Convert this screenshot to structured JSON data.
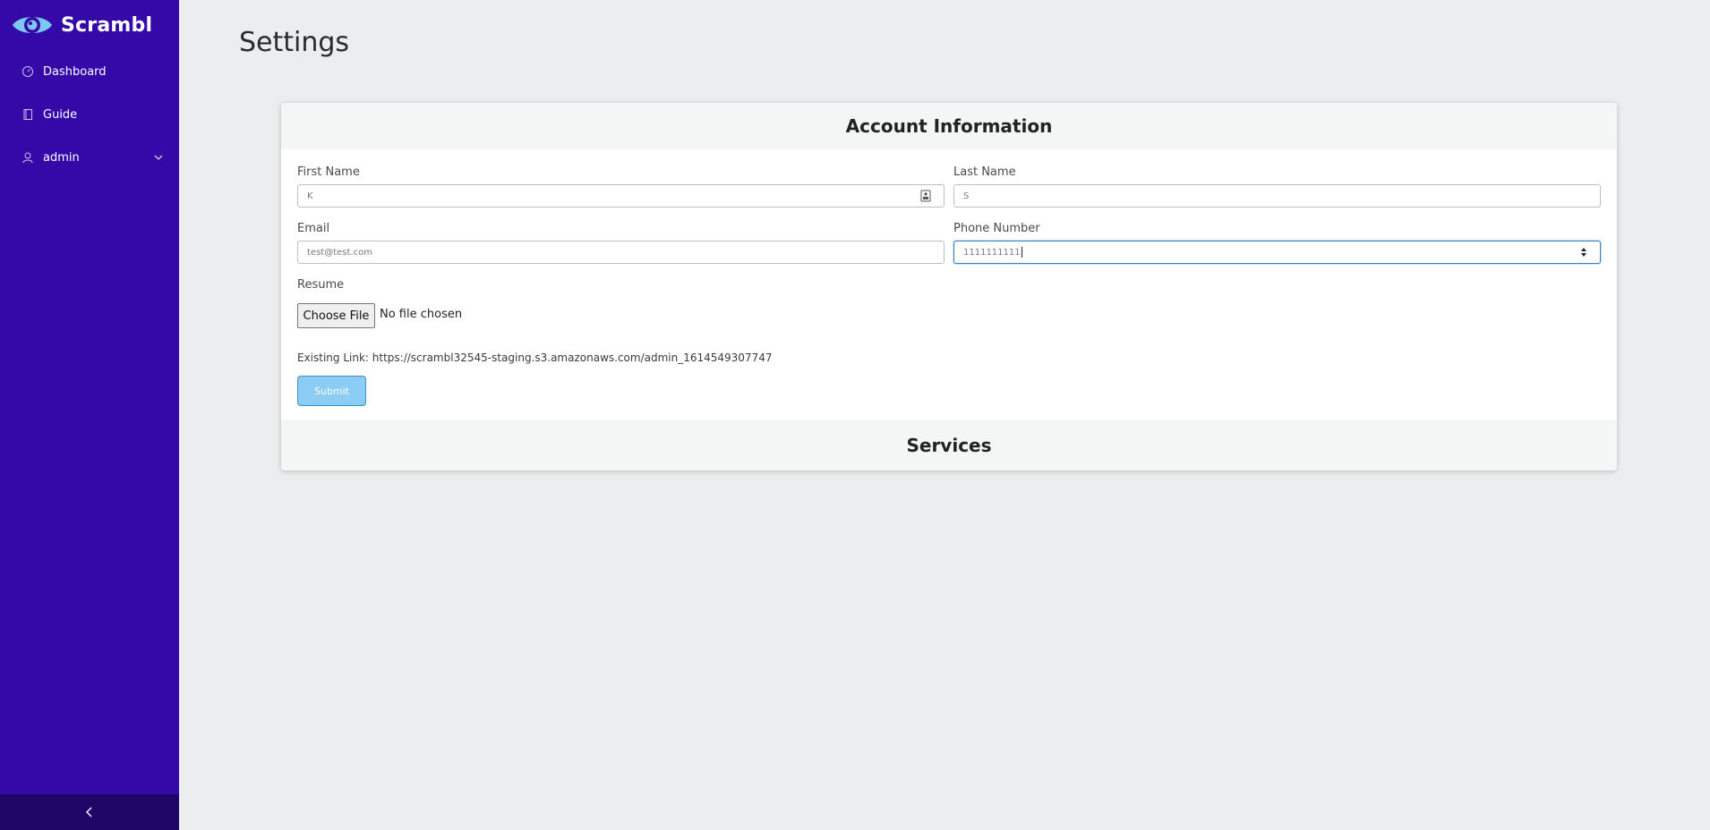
{
  "brand": {
    "name": "Scrambl"
  },
  "sidebar": {
    "items": [
      {
        "label": "Dashboard",
        "icon": "speedometer-icon"
      },
      {
        "label": "Guide",
        "icon": "book-icon"
      },
      {
        "label": "admin",
        "icon": "user-icon"
      }
    ],
    "toggle_icon": "chevron-left-icon"
  },
  "page": {
    "title": "Settings"
  },
  "account": {
    "header": "Account Information",
    "first_name": {
      "label": "First Name",
      "value": "K"
    },
    "last_name": {
      "label": "Last Name",
      "value": "S"
    },
    "email": {
      "label": "Email",
      "value": "test@test.com"
    },
    "phone": {
      "label": "Phone Number",
      "value": "1111111111"
    },
    "resume": {
      "label": "Resume",
      "button": "Choose File",
      "status": "No file chosen"
    },
    "existing_link": "Existing Link: https://scrambl32545-staging.s3.amazonaws.com/admin_1614549307747",
    "submit": "Submit"
  },
  "services": {
    "header": "Services"
  },
  "colors": {
    "sidebar": "#3409a8",
    "sidebar_footer": "#1e0566",
    "page_bg": "#ebedef",
    "submit_bg": "#8ccdf6",
    "focus": "#3b82c4",
    "logo_accent": "#7cc8f2"
  }
}
